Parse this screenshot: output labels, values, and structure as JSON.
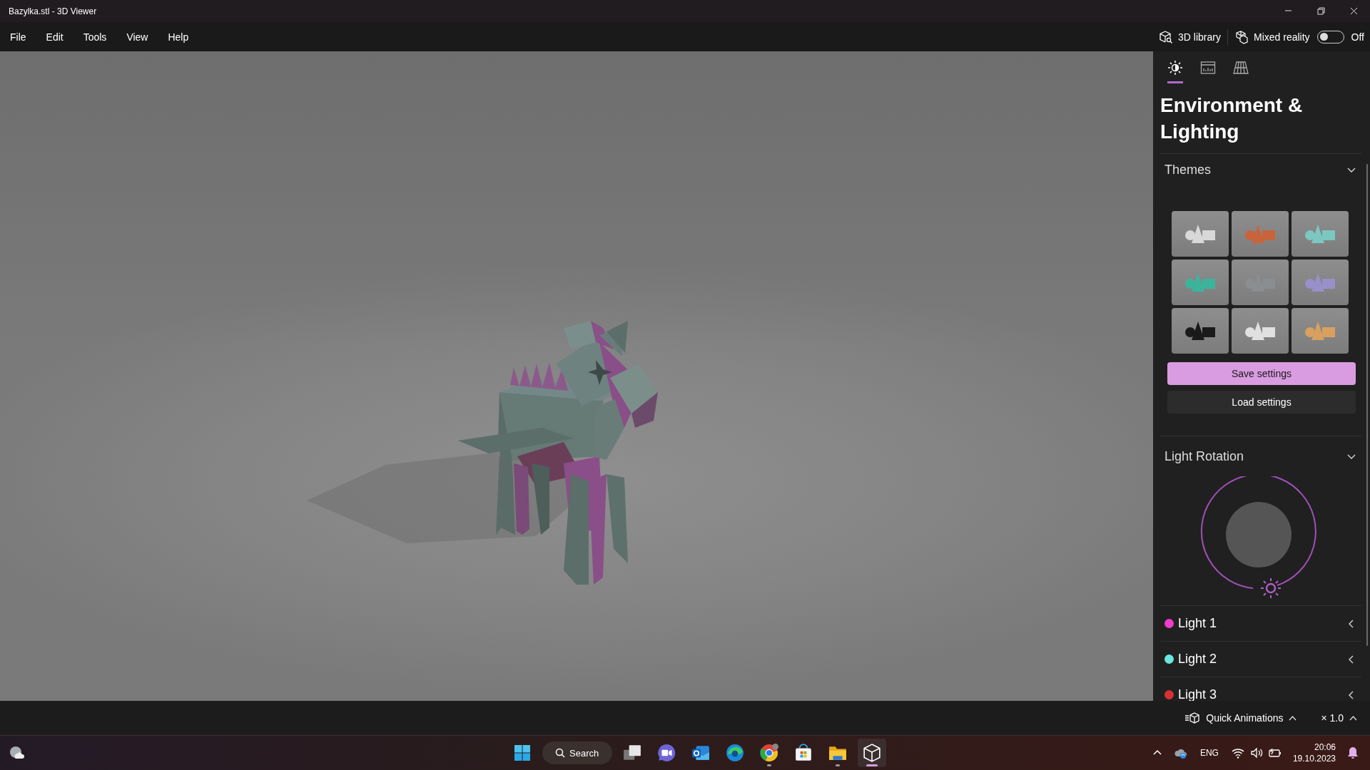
{
  "window": {
    "title": "Bazylka.stl - 3D Viewer"
  },
  "menu": [
    "File",
    "Edit",
    "Tools",
    "View",
    "Help"
  ],
  "toolbar": {
    "library_label": "3D library",
    "mixed_reality_label": "Mixed reality",
    "mixed_reality": {
      "on": false,
      "state_label": "Off"
    }
  },
  "panel": {
    "tabs": [
      {
        "kind": "lighting",
        "selected": true
      },
      {
        "kind": "stats",
        "selected": false
      },
      {
        "kind": "grid",
        "selected": false
      }
    ],
    "heading": "Environment & Lighting",
    "themes": {
      "title": "Themes",
      "expanded": true,
      "items": [
        {
          "color": "#d8d8d8"
        },
        {
          "color": "#c8643c"
        },
        {
          "color": "#7cc8c0"
        },
        {
          "color": "#3cb49c"
        },
        {
          "color": "#8a8e90"
        },
        {
          "color": "#9890c8"
        },
        {
          "color": "#1a1a1a"
        },
        {
          "color": "#e0e0e0"
        },
        {
          "color": "#d8a060"
        }
      ]
    },
    "buttons": [
      {
        "kind": "primary",
        "label": "Save settings"
      },
      {
        "kind": "secondary",
        "label": "Load settings"
      }
    ],
    "light_rotation": {
      "title": "Light Rotation",
      "expanded": true
    },
    "lights": [
      {
        "name": "Light 1",
        "color": "#f03cc8",
        "expanded": false
      },
      {
        "name": "Light 2",
        "color": "#6ae6e0",
        "expanded": false
      },
      {
        "name": "Light 3",
        "color": "#d83030",
        "expanded": false
      }
    ]
  },
  "status_bar": {
    "animations_label": "Quick Animations",
    "speed": "× 1.0"
  },
  "taskbar": {
    "search_label": "Search",
    "apps": [
      {
        "kind": "task-view",
        "running": false,
        "selected": false
      },
      {
        "kind": "chat",
        "running": false,
        "selected": false
      },
      {
        "kind": "mail",
        "running": false,
        "selected": false
      },
      {
        "kind": "browser",
        "running": false,
        "selected": false
      },
      {
        "kind": "browser-alt",
        "running": true,
        "selected": false
      },
      {
        "kind": "store",
        "running": false,
        "selected": false
      },
      {
        "kind": "folder",
        "running": true,
        "selected": false
      },
      {
        "kind": "cube",
        "running": true,
        "selected": true
      }
    ],
    "language": "ENG",
    "time": "20:06",
    "date": "19.10.2023"
  }
}
